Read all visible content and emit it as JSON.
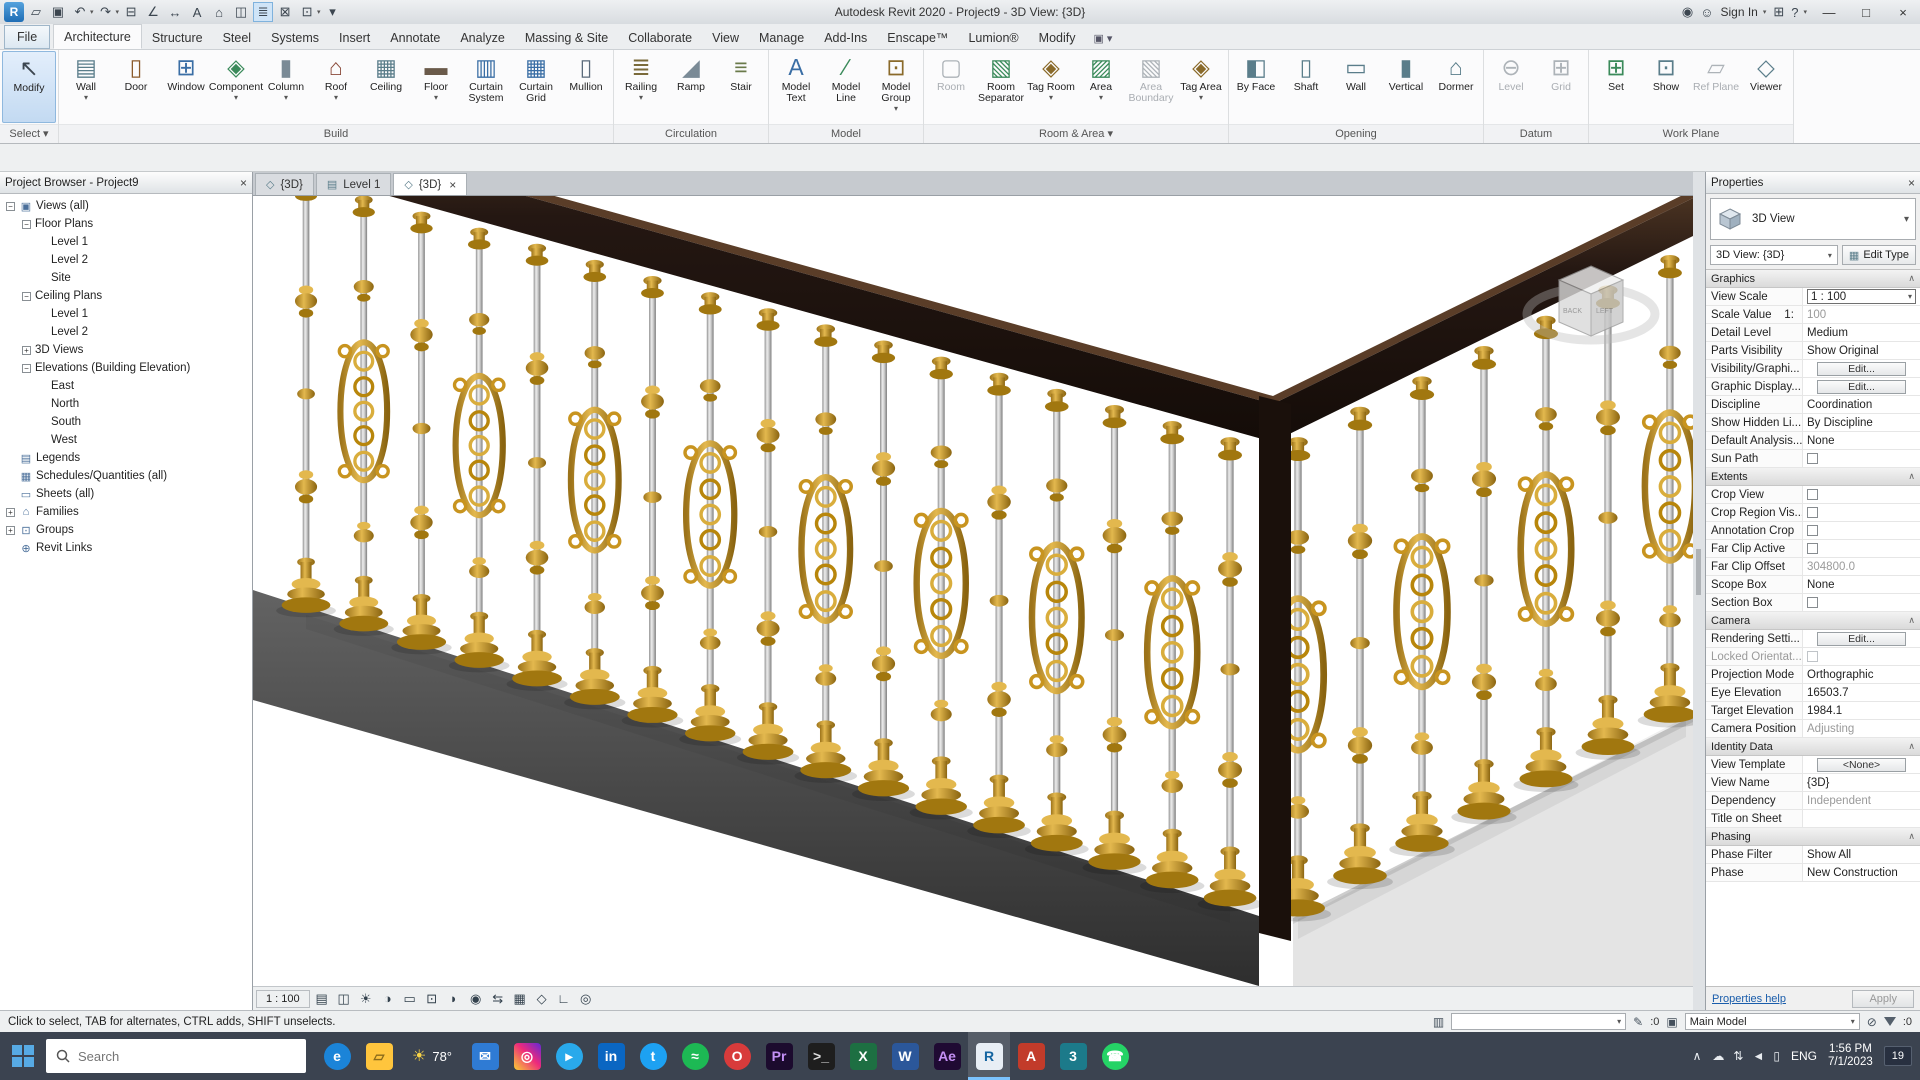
{
  "app": {
    "title": "Autodesk Revit 2020 - Project9 - 3D View: {3D}",
    "sign_in": "Sign In",
    "title_icons": {
      "notification": "◉",
      "user": "☺",
      "store": "⊞",
      "help": "?",
      "help_arrow": "▾",
      "signin_arrow": "▾"
    },
    "window": {
      "minimize": "—",
      "maximize": "□",
      "close": "×"
    }
  },
  "qat": [
    {
      "name": "app-button",
      "glyph": "R",
      "app": true
    },
    {
      "name": "open-file",
      "glyph": "▱"
    },
    {
      "name": "save",
      "glyph": "▣"
    },
    {
      "name": "undo",
      "glyph": "↶",
      "drop": true
    },
    {
      "name": "redo",
      "glyph": "↷",
      "drop": true
    },
    {
      "name": "print",
      "glyph": "⊟"
    },
    {
      "name": "measure",
      "glyph": "∠"
    },
    {
      "name": "aligned-dimension",
      "glyph": "↔"
    },
    {
      "name": "text",
      "glyph": "A"
    },
    {
      "name": "default-3d-view",
      "glyph": "⌂"
    },
    {
      "name": "section",
      "glyph": "◫"
    },
    {
      "name": "thin-lines",
      "glyph": "≣",
      "active": true
    },
    {
      "name": "close-inactive-views",
      "glyph": "⊠"
    },
    {
      "name": "switch-windows",
      "glyph": "⊡",
      "drop": true
    },
    {
      "name": "customize-qat",
      "glyph": "▾"
    }
  ],
  "ribbon": {
    "tabs": [
      "File",
      "Architecture",
      "Structure",
      "Steel",
      "Systems",
      "Insert",
      "Annotate",
      "Analyze",
      "Massing & Site",
      "Collaborate",
      "View",
      "Manage",
      "Add-Ins",
      "Enscape™",
      "Lumion®",
      "Modify"
    ],
    "active_tab": "Architecture",
    "options_icon": "▣ ▾",
    "panels": [
      {
        "label": "Select",
        "dropdown": true,
        "buttons": [
          {
            "label": "Modify",
            "glyph": "↖",
            "color": "#3c4650",
            "modify": true
          }
        ]
      },
      {
        "label": "Build",
        "buttons": [
          {
            "label": "Wall",
            "glyph": "▤",
            "color": "#5a7d8a",
            "drop": true
          },
          {
            "label": "Door",
            "glyph": "▯",
            "color": "#8a5a2a"
          },
          {
            "label": "Window",
            "glyph": "⊞",
            "color": "#3a6ea5"
          },
          {
            "label": "Component",
            "glyph": "◈",
            "color": "#3a8a5a",
            "drop": true
          },
          {
            "label": "Column",
            "glyph": "▮",
            "color": "#7a8a96",
            "drop": true
          },
          {
            "label": "Roof",
            "glyph": "⌂",
            "color": "#8a4a3a",
            "drop": true
          },
          {
            "label": "Ceiling",
            "glyph": "▦",
            "color": "#5a7d8a"
          },
          {
            "label": "Floor",
            "glyph": "▬",
            "color": "#6a5a4a",
            "drop": true
          },
          {
            "label": "Curtain System",
            "glyph": "▥",
            "color": "#3a6ea5"
          },
          {
            "label": "Curtain Grid",
            "glyph": "▦",
            "color": "#3a6ea5"
          },
          {
            "label": "Mullion",
            "glyph": "▯",
            "color": "#5a6a7a"
          }
        ]
      },
      {
        "label": "Circulation",
        "buttons": [
          {
            "label": "Railing",
            "glyph": "≣",
            "color": "#7a6a3a",
            "drop": true
          },
          {
            "label": "Ramp",
            "glyph": "◢",
            "color": "#7a8a96"
          },
          {
            "label": "Stair",
            "glyph": "≡",
            "color": "#6a7a4a"
          }
        ]
      },
      {
        "label": "Model",
        "buttons": [
          {
            "label": "Model Text",
            "glyph": "A",
            "color": "#3a6ea5"
          },
          {
            "label": "Model Line",
            "glyph": "∕",
            "color": "#3a8a5a"
          },
          {
            "label": "Model Group",
            "glyph": "⊡",
            "color": "#8a6a2a",
            "drop": true
          }
        ]
      },
      {
        "label": "Room & Area",
        "dropdown": true,
        "buttons": [
          {
            "label": "Room",
            "glyph": "▢",
            "disabled": true
          },
          {
            "label": "Room Separator",
            "glyph": "▧",
            "color": "#3a8a5a"
          },
          {
            "label": "Tag Room",
            "glyph": "◈",
            "color": "#8a6a2a",
            "drop": true
          },
          {
            "label": "Area",
            "glyph": "▨",
            "color": "#3a8a5a",
            "drop": true
          },
          {
            "label": "Area Boundary",
            "glyph": "▧",
            "disabled": true
          },
          {
            "label": "Tag Area",
            "glyph": "◈",
            "color": "#8a6a2a",
            "drop": true
          }
        ]
      },
      {
        "label": "Opening",
        "buttons": [
          {
            "label": "By Face",
            "glyph": "◧",
            "color": "#5a7d8a"
          },
          {
            "label": "Shaft",
            "glyph": "▯",
            "color": "#5a7d8a"
          },
          {
            "label": "Wall",
            "glyph": "▭",
            "color": "#5a7d8a"
          },
          {
            "label": "Vertical",
            "glyph": "▮",
            "color": "#5a7d8a"
          },
          {
            "label": "Dormer",
            "glyph": "⌂",
            "color": "#5a7d8a"
          }
        ]
      },
      {
        "label": "Datum",
        "buttons": [
          {
            "label": "Level",
            "glyph": "⊖",
            "disabled": true
          },
          {
            "label": "Grid",
            "glyph": "⊞",
            "disabled": true
          }
        ]
      },
      {
        "label": "Work Plane",
        "buttons": [
          {
            "label": "Set",
            "glyph": "⊞",
            "color": "#3a8a5a"
          },
          {
            "label": "Show",
            "glyph": "⊡",
            "color": "#5a7d8a"
          },
          {
            "label": "Ref Plane",
            "glyph": "▱",
            "disabled": true
          },
          {
            "label": "Viewer",
            "glyph": "◇",
            "color": "#5a7d8a"
          }
        ]
      }
    ]
  },
  "project_browser": {
    "title": "Project Browser - Project9",
    "items": [
      {
        "d": 0,
        "e": "-",
        "icon": "views",
        "label": "Views (all)"
      },
      {
        "d": 1,
        "e": "-",
        "label": "Floor Plans"
      },
      {
        "d": 2,
        "label": "Level 1"
      },
      {
        "d": 2,
        "label": "Level 2"
      },
      {
        "d": 2,
        "label": "Site"
      },
      {
        "d": 1,
        "e": "-",
        "label": "Ceiling Plans"
      },
      {
        "d": 2,
        "label": "Level 1"
      },
      {
        "d": 2,
        "label": "Level 2"
      },
      {
        "d": 1,
        "e": "+",
        "label": "3D Views"
      },
      {
        "d": 1,
        "e": "-",
        "label": "Elevations (Building Elevation)"
      },
      {
        "d": 2,
        "label": "East"
      },
      {
        "d": 2,
        "label": "North"
      },
      {
        "d": 2,
        "label": "South"
      },
      {
        "d": 2,
        "label": "West"
      },
      {
        "d": 0,
        "icon": "legend",
        "label": "Legends"
      },
      {
        "d": 0,
        "icon": "schedule",
        "label": "Schedules/Quantities (all)"
      },
      {
        "d": 0,
        "icon": "sheet",
        "label": "Sheets (all)"
      },
      {
        "d": 0,
        "e": "+",
        "icon": "family",
        "label": "Families"
      },
      {
        "d": 0,
        "e": "+",
        "icon": "group",
        "label": "Groups"
      },
      {
        "d": 0,
        "icon": "link",
        "label": "Revit Links"
      }
    ],
    "tree_icons": {
      "views": "▣",
      "legend": "▤",
      "schedule": "▦",
      "sheet": "▭",
      "family": "⌂",
      "group": "⊡",
      "link": "⊕"
    }
  },
  "view_tabs": [
    {
      "label": "{3D}",
      "icon": "◇"
    },
    {
      "label": "Level 1",
      "icon": "▤"
    },
    {
      "label": "{3D}",
      "icon": "◇",
      "active": true,
      "close": "×"
    }
  ],
  "view_bar": {
    "scale": "1 : 100",
    "icons": [
      {
        "name": "detail-level",
        "glyph": "▤"
      },
      {
        "name": "visual-style",
        "glyph": "◫"
      },
      {
        "name": "sun-path",
        "glyph": "☀"
      },
      {
        "name": "shadows",
        "glyph": "◑"
      },
      {
        "name": "crop-view",
        "glyph": "▭"
      },
      {
        "name": "show-crop-region",
        "glyph": "⊡"
      },
      {
        "name": "temporary-hide-isolate",
        "glyph": "◗"
      },
      {
        "name": "reveal-hidden-elements",
        "glyph": "◉"
      },
      {
        "name": "worksharing-display",
        "glyph": "⇆"
      },
      {
        "name": "temporary-view-properties",
        "glyph": "▦"
      },
      {
        "name": "displaced-elements",
        "glyph": "◇"
      },
      {
        "name": "reveal-constraints",
        "glyph": "∟"
      },
      {
        "name": "analytical-model",
        "glyph": "◎"
      }
    ]
  },
  "properties": {
    "title": "Properties",
    "type_label": "3D View",
    "selector": "3D View: {3D}",
    "edit_type": "Edit Type",
    "help": "Properties help",
    "apply": "Apply",
    "sections": [
      {
        "name": "Graphics",
        "rows": [
          {
            "label": "View Scale",
            "value": "1 : 100",
            "kind": "combo"
          },
          {
            "label": "Scale Value    1:",
            "value": "100",
            "disabled": true
          },
          {
            "label": "Detail Level",
            "value": "Medium"
          },
          {
            "label": "Parts Visibility",
            "value": "Show Original"
          },
          {
            "label": "Visibility/Graphi...",
            "value": "Edit...",
            "kind": "button"
          },
          {
            "label": "Graphic Display...",
            "value": "Edit...",
            "kind": "button"
          },
          {
            "label": "Discipline",
            "value": "Coordination"
          },
          {
            "label": "Show Hidden Li...",
            "value": "By Discipline"
          },
          {
            "label": "Default Analysis...",
            "value": "None"
          },
          {
            "label": "Sun Path",
            "kind": "check"
          }
        ]
      },
      {
        "name": "Extents",
        "rows": [
          {
            "label": "Crop View",
            "kind": "check"
          },
          {
            "label": "Crop Region Vis...",
            "kind": "check"
          },
          {
            "label": "Annotation Crop",
            "kind": "check"
          },
          {
            "label": "Far Clip Active",
            "kind": "check"
          },
          {
            "label": "Far Clip Offset",
            "value": "304800.0",
            "disabled": true
          },
          {
            "label": "Scope Box",
            "value": "None"
          },
          {
            "label": "Section Box",
            "kind": "check"
          }
        ]
      },
      {
        "name": "Camera",
        "rows": [
          {
            "label": "Rendering Setti...",
            "value": "Edit...",
            "kind": "button"
          },
          {
            "label": "Locked Orientat...",
            "kind": "check",
            "disabled": true
          },
          {
            "label": "Projection Mode",
            "value": "Orthographic"
          },
          {
            "label": "Eye Elevation",
            "value": "16503.7"
          },
          {
            "label": "Target Elevation",
            "value": "1984.1"
          },
          {
            "label": "Camera Position",
            "value": "Adjusting",
            "disabled": true
          }
        ]
      },
      {
        "name": "Identity Data",
        "rows": [
          {
            "label": "View Template",
            "value": "<None>",
            "kind": "button"
          },
          {
            "label": "View Name",
            "value": "{3D}"
          },
          {
            "label": "Dependency",
            "value": "Independent",
            "disabled": true
          },
          {
            "label": "Title on Sheet",
            "value": ""
          }
        ]
      },
      {
        "name": "Phasing",
        "rows": [
          {
            "label": "Phase Filter",
            "value": "Show All"
          },
          {
            "label": "Phase",
            "value": "New Construction"
          }
        ]
      }
    ]
  },
  "status_bar": {
    "hint": "Click to select, TAB for alternates, CTRL adds, SHIFT unselects.",
    "workset_value": "",
    "design_option": "Main Model",
    "editable_count": ":0",
    "selection_count": ":0"
  },
  "viewport": {
    "viewcube": {
      "face_left": "BACK",
      "face_right": "LEFT"
    },
    "colors": {
      "gold": "#c8941f",
      "gold_dark": "#a1770f",
      "gold_light": "#e3b84e",
      "rail": "#241712",
      "chrome": "#c9c9c9",
      "slab_dark": "#3f3f3f",
      "floor": "#ffffff"
    }
  },
  "taskbar": {
    "search_placeholder": "Search",
    "weather_temp": "78°",
    "weather_icon": "☀",
    "apps": [
      {
        "name": "edge",
        "label": "e",
        "bg": "#1b84d8",
        "fg": "#ffffff",
        "round": true
      },
      {
        "name": "file-explorer",
        "label": "▱",
        "bg": "#ffc53d",
        "fg": "#8a6a1a"
      },
      {
        "name": "weather",
        "kind": "chip"
      },
      {
        "name": "mail",
        "label": "✉",
        "bg": "#2f7bd4",
        "fg": "#ffffff"
      },
      {
        "name": "instagram",
        "label": "◎",
        "bg": "insta",
        "fg": "#ffffff"
      },
      {
        "name": "telegram",
        "label": "▸",
        "bg": "#29a9eb",
        "fg": "#ffffff",
        "round": true
      },
      {
        "name": "linkedin",
        "label": "in",
        "bg": "#0a66c2",
        "fg": "#ffffff"
      },
      {
        "name": "twitter",
        "label": "t",
        "bg": "#1da1f2",
        "fg": "#ffffff",
        "round": true
      },
      {
        "name": "spotify",
        "label": "≈",
        "bg": "#1db954",
        "fg": "#ffffff",
        "round": true
      },
      {
        "name": "opera",
        "label": "O",
        "bg": "#d83b3b",
        "fg": "#ffffff",
        "round": true
      },
      {
        "name": "premiere",
        "label": "Pr",
        "bg": "#1c0b2e",
        "fg": "#c490f5"
      },
      {
        "name": "terminal",
        "label": ">_",
        "bg": "#1e1e1e",
        "fg": "#dddddd"
      },
      {
        "name": "excel",
        "label": "X",
        "bg": "#1d6f42",
        "fg": "#ffffff"
      },
      {
        "name": "word",
        "label": "W",
        "bg": "#2b579a",
        "fg": "#ffffff"
      },
      {
        "name": "after-effects",
        "label": "Ae",
        "bg": "#1f0a33",
        "fg": "#c490f5"
      },
      {
        "name": "revit",
        "label": "R",
        "bg": "#e8eef5",
        "fg": "#1464a0",
        "active": true
      },
      {
        "name": "autocad",
        "label": "A",
        "bg": "#c23b2a",
        "fg": "#ffffff"
      },
      {
        "name": "3ds-max",
        "label": "3",
        "bg": "#1c7a8a",
        "fg": "#ffffff"
      },
      {
        "name": "whatsapp",
        "label": "☎",
        "bg": "#25d366",
        "fg": "#ffffff",
        "round": true
      }
    ],
    "tray": {
      "chevron": "∧",
      "icons": [
        {
          "name": "onedrive-icon",
          "glyph": "☁"
        },
        {
          "name": "network-icon",
          "glyph": "⇅"
        },
        {
          "name": "volume-icon",
          "glyph": "◄"
        },
        {
          "name": "battery-icon",
          "glyph": "▯"
        }
      ],
      "lang": "ENG",
      "time": "1:56 PM",
      "date": "7/1/2023",
      "badge": "19"
    }
  }
}
